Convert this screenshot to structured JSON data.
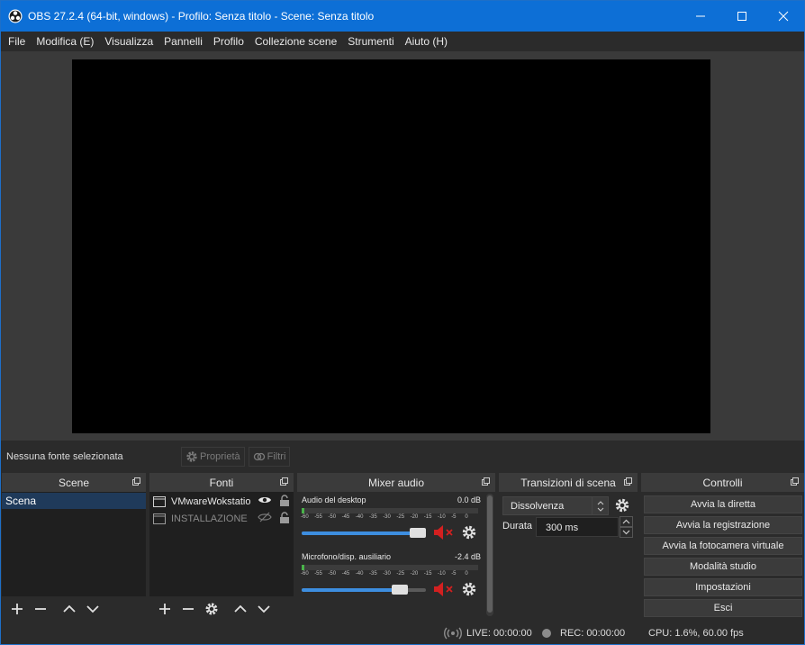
{
  "window": {
    "title": "OBS 27.2.4 (64-bit, windows) - Profilo: Senza titolo - Scene: Senza titolo"
  },
  "menu": [
    "File",
    "Modifica (E)",
    "Visualizza",
    "Pannelli",
    "Profilo",
    "Collezione scene",
    "Strumenti",
    "Aiuto (H)"
  ],
  "source_toolbar": {
    "no_source": "Nessuna fonte selezionata",
    "properties": "Proprietà",
    "filters": "Filtri"
  },
  "docks": {
    "scenes": {
      "title": "Scene",
      "items": [
        "Scena"
      ]
    },
    "sources": {
      "title": "Fonti",
      "items": [
        {
          "label": "VMwareWokstatio",
          "visible": true,
          "locked": false
        },
        {
          "label": "INSTALLAZIONE",
          "visible": false,
          "locked": false
        }
      ]
    },
    "mixer": {
      "title": "Mixer audio",
      "scale": [
        "-60",
        "-55",
        "-50",
        "-45",
        "-40",
        "-35",
        "-30",
        "-25",
        "-20",
        "-15",
        "-10",
        "-5",
        "0"
      ],
      "channels": [
        {
          "name": "Audio del desktop",
          "db": "0.0 dB",
          "volume": 1.0,
          "muted": true
        },
        {
          "name": "Microfono/disp. ausiliario",
          "db": "-2.4 dB",
          "volume": 0.83,
          "muted": true
        }
      ]
    },
    "transitions": {
      "title": "Transizioni di scena",
      "selected": "Dissolvenza",
      "duration_label": "Durata",
      "duration_value": "300 ms"
    },
    "controls": {
      "title": "Controlli",
      "buttons": [
        "Avvia la diretta",
        "Avvia la registrazione",
        "Avvia la fotocamera virtuale",
        "Modalità studio",
        "Impostazioni",
        "Esci"
      ]
    }
  },
  "status": {
    "live": "LIVE: 00:00:00",
    "rec": "REC: 00:00:00",
    "cpu": "CPU: 1.6%, 60.00 fps"
  },
  "colors": {
    "titlebar": "#0d6fd6",
    "mute": "#d32020",
    "fader": "#3d8ee0",
    "meter": "#4ab34a"
  }
}
